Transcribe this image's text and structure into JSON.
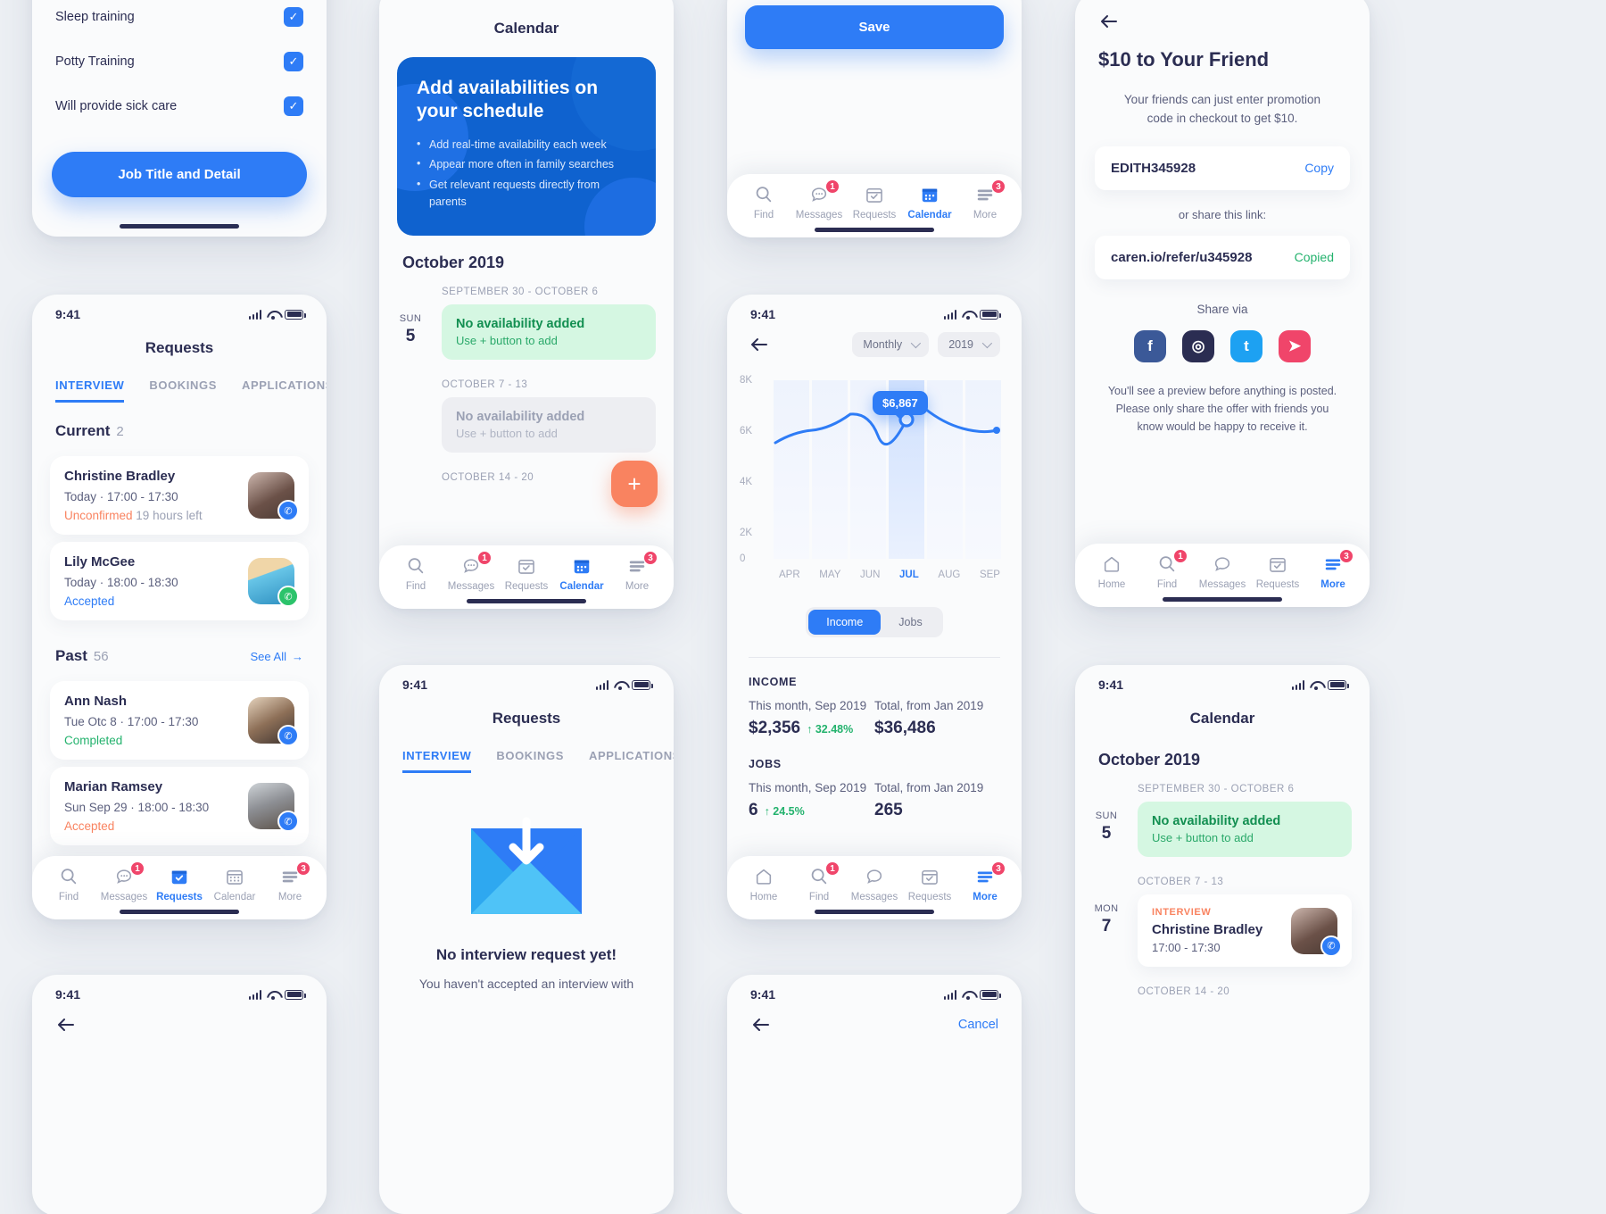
{
  "job_detail": {
    "items": [
      {
        "label": "Sleep training",
        "checked": true
      },
      {
        "label": "Potty Training",
        "checked": true
      },
      {
        "label": "Will provide sick care",
        "checked": true
      }
    ],
    "cta": "Job Title and Detail"
  },
  "requests": {
    "status_time": "9:41",
    "title": "Requests",
    "tabs": [
      {
        "label": "INTERVIEW",
        "active": true
      },
      {
        "label": "BOOKINGS",
        "active": false
      },
      {
        "label": "APPLICATIONS",
        "active": false
      }
    ],
    "current": {
      "label": "Current",
      "count": "2"
    },
    "past": {
      "label": "Past",
      "count": "56",
      "see_all": "See All"
    },
    "current_items": [
      {
        "name": "Christine Bradley",
        "time": "Today  ·  17:00 - 17:30",
        "status": "Unconfirmed",
        "status_extra": "19 hours left",
        "status_kind": "unconf",
        "action": "call"
      },
      {
        "name": "Lily McGee",
        "time": "Today  ·  18:00 - 18:30",
        "status": "Accepted",
        "status_extra": "",
        "status_kind": "acc",
        "action": "chat"
      }
    ],
    "past_items": [
      {
        "name": "Ann Nash",
        "time": "Tue Otc 8  ·  17:00 - 17:30",
        "status": "Completed",
        "status_extra": "",
        "status_kind": "comp",
        "action": "call"
      },
      {
        "name": "Marian Ramsey",
        "time": "Sun Sep 29  ·  18:00 - 18:30",
        "status": "Accepted",
        "status_extra": "",
        "status_kind": "accw",
        "action": "call"
      }
    ],
    "tabbar": [
      {
        "label": "Find",
        "icon": "search-icon",
        "active": false,
        "badge": ""
      },
      {
        "label": "Messages",
        "icon": "chat-icon",
        "active": false,
        "badge": "1"
      },
      {
        "label": "Requests",
        "icon": "calendar-check-icon",
        "active": true,
        "badge": ""
      },
      {
        "label": "Calendar",
        "icon": "calendar-icon",
        "active": false,
        "badge": ""
      },
      {
        "label": "More",
        "icon": "more-lines-icon",
        "active": false,
        "badge": "3"
      }
    ]
  },
  "empty_requests": {
    "status_time": "9:41",
    "title": "Requests",
    "tabs": [
      {
        "label": "INTERVIEW",
        "active": true
      },
      {
        "label": "BOOKINGS",
        "active": false
      },
      {
        "label": "APPLICATIONS",
        "active": false
      }
    ],
    "heading": "No interview request yet!",
    "body": "You haven't accepted an interview with"
  },
  "calendar": {
    "title": "Calendar",
    "promo": {
      "heading": "Add availabilities on your schedule",
      "bullets": [
        "Add real-time availability each week",
        "Appear more often in family searches",
        "Get relevant requests directly from parents"
      ]
    },
    "month": "October 2019",
    "weeks": [
      {
        "range": "SEPTEMBER 30 - OCTOBER 6",
        "day_word": "SUN",
        "day_num": "5",
        "slot_kind": "green",
        "slot_title": "No availability added",
        "slot_sub": "Use + button to add"
      },
      {
        "range": "OCTOBER 7 - 13",
        "day_word": "",
        "day_num": "",
        "slot_kind": "grey",
        "slot_title": "No availability added",
        "slot_sub": "Use + button to add"
      },
      {
        "range": "OCTOBER 14 - 20",
        "day_word": "",
        "day_num": "",
        "slot_kind": "none",
        "slot_title": "",
        "slot_sub": ""
      }
    ],
    "fab": "+",
    "tabbar": [
      {
        "label": "Find",
        "icon": "search-icon",
        "active": false,
        "badge": ""
      },
      {
        "label": "Messages",
        "icon": "chat-icon",
        "active": false,
        "badge": "1"
      },
      {
        "label": "Requests",
        "icon": "calendar-check-icon",
        "active": false,
        "badge": ""
      },
      {
        "label": "Calendar",
        "icon": "calendar-icon",
        "active": true,
        "badge": ""
      },
      {
        "label": "More",
        "icon": "more-lines-icon",
        "active": false,
        "badge": "3"
      }
    ]
  },
  "calendar_right": {
    "status_time": "9:41",
    "title": "Calendar",
    "month": "October 2019",
    "week1_range": "SEPTEMBER 30 - OCTOBER 6",
    "week1_day_word": "SUN",
    "week1_day_num": "5",
    "week1_title": "No availability added",
    "week1_sub": "Use + button to add",
    "week2_range": "OCTOBER 7 - 13",
    "week2_day_word": "MON",
    "week2_day_num": "7",
    "week2_tag": "INTERVIEW",
    "week2_name": "Christine Bradley",
    "week2_time": "17:00 - 17:30",
    "week3_range": "OCTOBER 14 - 20"
  },
  "save_screen": {
    "save_label": "Save",
    "tabbar": [
      {
        "label": "Find",
        "icon": "search-icon",
        "active": false,
        "badge": ""
      },
      {
        "label": "Messages",
        "icon": "chat-icon",
        "active": false,
        "badge": "1"
      },
      {
        "label": "Requests",
        "icon": "calendar-check-icon",
        "active": false,
        "badge": ""
      },
      {
        "label": "Calendar",
        "icon": "calendar-icon",
        "active": true,
        "badge": ""
      },
      {
        "label": "More",
        "icon": "more-lines-icon",
        "active": false,
        "badge": "3"
      }
    ]
  },
  "income": {
    "status_time": "9:41",
    "period_select": "Monthly",
    "year_select": "2019",
    "tooltip": "$6,867",
    "segments": [
      {
        "label": "Income",
        "active": true
      },
      {
        "label": "Jobs",
        "active": false
      }
    ],
    "income_cap": "INCOME",
    "income_this_label": "This month, Sep 2019",
    "income_this_value": "$2,356",
    "income_this_delta": "↑ 32.48%",
    "income_total_label": "Total, from Jan 2019",
    "income_total_value": "$36,486",
    "jobs_cap": "JOBS",
    "jobs_this_label": "This month, Sep 2019",
    "jobs_this_value": "6",
    "jobs_this_delta": "↑ 24.5%",
    "jobs_total_label": "Total, from Jan 2019",
    "jobs_total_value": "265",
    "tabbar": [
      {
        "label": "Home",
        "icon": "home-icon",
        "active": false,
        "badge": ""
      },
      {
        "label": "Find",
        "icon": "search-icon",
        "active": false,
        "badge": "1"
      },
      {
        "label": "Messages",
        "icon": "chat-icon",
        "active": false,
        "badge": ""
      },
      {
        "label": "Requests",
        "icon": "calendar-check-icon",
        "active": false,
        "badge": ""
      },
      {
        "label": "More",
        "icon": "more-lines-icon",
        "active": true,
        "badge": "3"
      }
    ]
  },
  "referral": {
    "title": "$10 to Your Friend",
    "subtitle": "Your friends can just enter promotion code in checkout to get $10.",
    "promo_code": "EDITH345928",
    "copy_label": "Copy",
    "or_share": "or share this link:",
    "link": "caren.io/refer/u345928",
    "copied_label": "Copied",
    "share_via": "Share via",
    "socials": [
      {
        "name": "facebook-icon",
        "glyph": "f",
        "color": "#3b5998"
      },
      {
        "name": "instagram-icon",
        "glyph": "◎",
        "color": "#2b2d52"
      },
      {
        "name": "twitter-icon",
        "glyph": "t",
        "color": "#1da1f2"
      },
      {
        "name": "telegram-icon",
        "glyph": "➤",
        "color": "#f0456a"
      }
    ],
    "note": "You'll see a preview before anything is posted. Please only share the offer with friends you know would be happy to receive it.",
    "tabbar": [
      {
        "label": "Home",
        "icon": "home-icon",
        "active": false,
        "badge": ""
      },
      {
        "label": "Find",
        "icon": "search-icon",
        "active": false,
        "badge": "1"
      },
      {
        "label": "Messages",
        "icon": "chat-icon",
        "active": false,
        "badge": ""
      },
      {
        "label": "Requests",
        "icon": "calendar-check-icon",
        "active": false,
        "badge": ""
      },
      {
        "label": "More",
        "icon": "more-lines-icon",
        "active": true,
        "badge": "3"
      }
    ]
  },
  "cancel_screen": {
    "status_time": "9:41",
    "cancel_label": "Cancel"
  },
  "chart_data": {
    "type": "line",
    "title": "",
    "categories": [
      "APR",
      "MAY",
      "JUN",
      "JUL",
      "AUG",
      "SEP"
    ],
    "values": [
      5200,
      6000,
      4900,
      6867,
      5750,
      5600
    ],
    "highlight_category": "JUL",
    "highlight_value": 6867,
    "highlight_label": "$6,867",
    "ylabel": "",
    "xlabel": "",
    "ylim": [
      0,
      8000
    ],
    "yticks": [
      "8K",
      "6K",
      "4K",
      "2K",
      "0"
    ],
    "ytick_values": [
      8000,
      6000,
      4000,
      2000,
      0
    ],
    "grid": true,
    "legend": "none",
    "line_color": "#2e7cf6"
  }
}
